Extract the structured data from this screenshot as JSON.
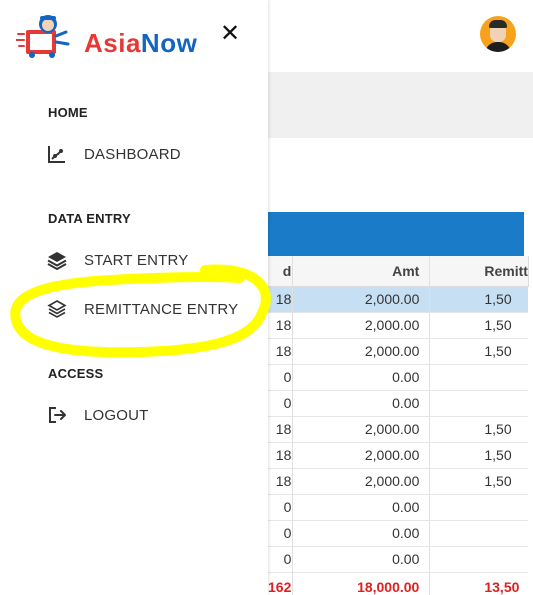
{
  "brand": {
    "name_part1": "Asia",
    "name_part2": "Now",
    "color_primary": "#e53935",
    "color_secondary": "#1565c0"
  },
  "header": {
    "close_icon": "close-icon",
    "close_glyph": "✕",
    "avatar_icon": "avatar"
  },
  "drawer": {
    "sections": [
      {
        "title": "HOME",
        "items": [
          {
            "label": "DASHBOARD",
            "icon": "chart-icon"
          }
        ]
      },
      {
        "title": "DATA ENTRY",
        "items": [
          {
            "label": "START ENTRY",
            "icon": "layers-filled-icon"
          },
          {
            "label": "REMITTANCE ENTRY",
            "icon": "layers-outline-icon",
            "highlighted": true
          }
        ]
      },
      {
        "title": "ACCESS",
        "items": [
          {
            "label": "LOGOUT",
            "icon": "logout-icon"
          }
        ]
      }
    ]
  },
  "table": {
    "accent_color": "#1a7cc9",
    "headers": [
      "d",
      "Amt",
      "Remitt"
    ],
    "rows": [
      [
        "18",
        "2,000.00",
        "1,50",
        true
      ],
      [
        "18",
        "2,000.00",
        "1,50",
        false
      ],
      [
        "18",
        "2,000.00",
        "1,50",
        false
      ],
      [
        "0",
        "0.00",
        "",
        false
      ],
      [
        "0",
        "0.00",
        "",
        false
      ],
      [
        "18",
        "2,000.00",
        "1,50",
        false
      ],
      [
        "18",
        "2,000.00",
        "1,50",
        false
      ],
      [
        "18",
        "2,000.00",
        "1,50",
        false
      ],
      [
        "0",
        "0.00",
        "",
        false
      ],
      [
        "0",
        "0.00",
        "",
        false
      ],
      [
        "0",
        "0.00",
        "",
        false
      ]
    ],
    "total": [
      "162",
      "18,000.00",
      "13,50"
    ]
  },
  "annotation": {
    "highlight_color": "#ffff00"
  }
}
